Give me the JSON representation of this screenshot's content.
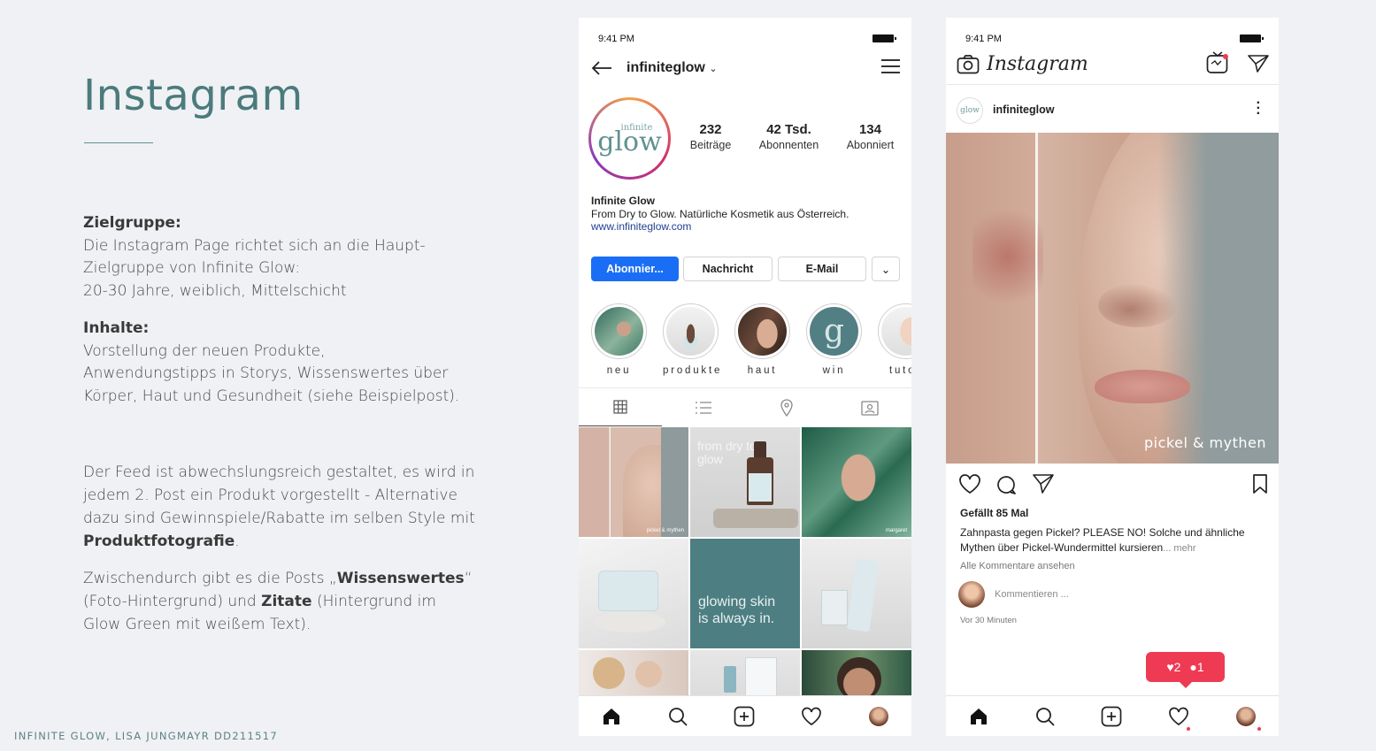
{
  "slide": {
    "title": "Instagram",
    "section1_head": "Zielgruppe:",
    "section1_lines": [
      "Die Instagram Page richtet sich an die Haupt-",
      "Zielgruppe von Infinite Glow:",
      "20-30 Jahre, weiblich, Mittelschicht"
    ],
    "section2_head": "Inhalte:",
    "section2_lines": [
      "Vorstellung der neuen Produkte,",
      "Anwendungstipps in Storys, Wissenswertes über",
      "Körper, Haut und Gesundheit (siehe Beispielpost)."
    ],
    "para3_a": "Der Feed ist abwechslungsreich gestaltet, es wird in jedem 2. Post ein Produkt vorgestellt - Alternative dazu sind Gewinnspiele/Rabatte im selben Style mit ",
    "para3_bold": "Produktfotografie",
    "para3_end": ".",
    "para4_a": "Zwischendurch gibt es die Posts „",
    "para4_bold1": "Wissenswertes",
    "para4_b": "“ (Foto-Hintergrund) und ",
    "para4_bold2": "Zitate",
    "para4_c": " (Hintergrund im Glow Green mit weißem Text).",
    "footer": "INFINITE GLOW, LISA JUNGMAYR DD211517"
  },
  "profile_phone": {
    "time": "9:41 PM",
    "username": "infiniteglow",
    "avatar_small": "infinite",
    "avatar_big": "glow",
    "stats": [
      {
        "num": "232",
        "label": "Beiträge"
      },
      {
        "num": "42 Tsd.",
        "label": "Abonnenten"
      },
      {
        "num": "134",
        "label": "Abonniert"
      }
    ],
    "bio_name": "Infinite Glow",
    "bio_text": "From Dry to Glow. Natürliche Kosmetik aus Österreich.",
    "bio_link": "www.infiniteglow.com",
    "buttons": {
      "follow": "Abonnier...",
      "message": "Nachricht",
      "email": "E-Mail"
    },
    "highlights": [
      "neu",
      "produkte",
      "haut",
      "win",
      "tutor"
    ],
    "grid_texts": {
      "tile1": "pickel & mythen",
      "tile2": "from dry to glow",
      "tile3": "margaret",
      "tile5_l1": "glowing skin",
      "tile5_l2": "is always in."
    }
  },
  "post_phone": {
    "time": "9:41 PM",
    "brand": "Instagram",
    "avatar": "glow",
    "username": "infiniteglow",
    "image_caption": "pickel & mythen",
    "likes": "Gefällt 85 Mal",
    "caption": "Zahnpasta gegen Pickel? PLEASE NO! Solche und ähnliche Mythen über Pickel-Wundermittel kursieren",
    "more": "... mehr",
    "all_comments": "Alle Kommentare ansehen",
    "comment_placeholder": "Kommentieren ...",
    "time_ago": "Vor 30 Minuten",
    "notif_likes": "2",
    "notif_comments": "1"
  },
  "colors": {
    "accent_green": "#4b7b7c",
    "follow_blue": "#1a6ef5",
    "notif_red": "#ef3a53"
  }
}
